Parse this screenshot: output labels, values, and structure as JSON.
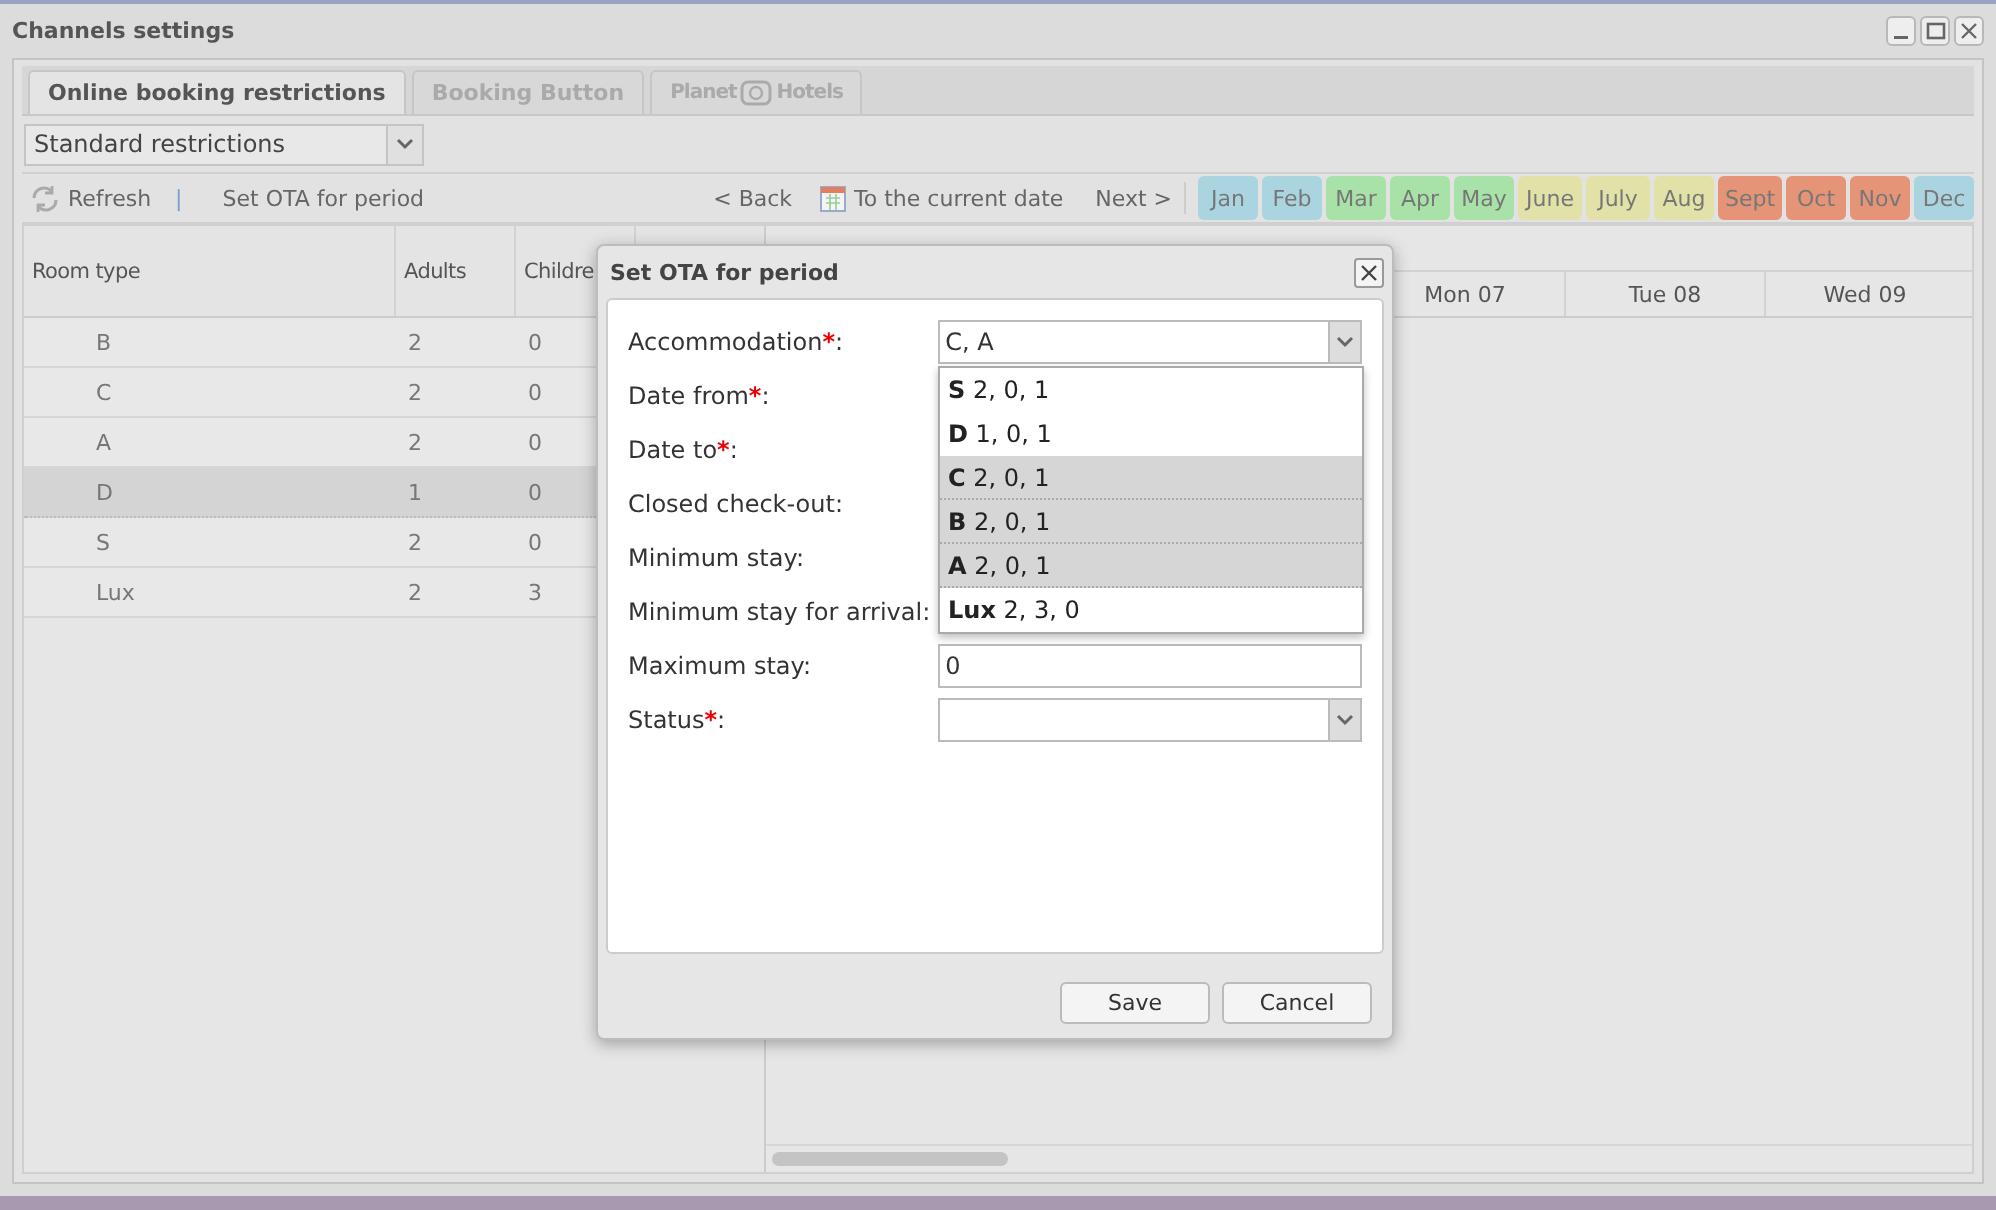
{
  "window": {
    "title": "Channels settings"
  },
  "tabs": [
    {
      "kind": "text",
      "label": "Online booking restrictions",
      "selected": true
    },
    {
      "kind": "text",
      "label": "Booking Button",
      "selected": false
    },
    {
      "kind": "logo",
      "parts": [
        "Planet",
        "Hotels"
      ],
      "selected": false
    }
  ],
  "restriction_type": {
    "value": "Standard restrictions"
  },
  "toolbar": {
    "refresh": "Refresh",
    "separator": "|",
    "set_ota": "Set OTA for period",
    "back": "< Back",
    "current_date": "To the current date",
    "next": "Next >"
  },
  "months": [
    {
      "label": "Jan",
      "color": "#a9d4e0"
    },
    {
      "label": "Feb",
      "color": "#a9d4e0"
    },
    {
      "label": "Mar",
      "color": "#a8e2a8"
    },
    {
      "label": "Apr",
      "color": "#a8e2a8"
    },
    {
      "label": "May",
      "color": "#a8e2a8"
    },
    {
      "label": "June",
      "color": "#e2e2a8"
    },
    {
      "label": "July",
      "color": "#e2e2a8"
    },
    {
      "label": "Aug",
      "color": "#e2e2a8"
    },
    {
      "label": "Sept",
      "color": "#e69478"
    },
    {
      "label": "Oct",
      "color": "#e69478"
    },
    {
      "label": "Nov",
      "color": "#e69478"
    },
    {
      "label": "Dec",
      "color": "#a9d4e0"
    }
  ],
  "table": {
    "columns": [
      "Room type",
      "Adults",
      "Childre"
    ],
    "rows": [
      {
        "cells": [
          "B",
          "2",
          "0"
        ],
        "selected": false
      },
      {
        "cells": [
          "C",
          "2",
          "0"
        ],
        "selected": false
      },
      {
        "cells": [
          "A",
          "2",
          "0"
        ],
        "selected": false
      },
      {
        "cells": [
          "D",
          "1",
          "0"
        ],
        "selected": true
      },
      {
        "cells": [
          "S",
          "2",
          "0"
        ],
        "selected": false
      },
      {
        "cells": [
          "Lux",
          "2",
          "3"
        ],
        "selected": false
      }
    ]
  },
  "calendar": {
    "days": [
      "Mon 07",
      "Tue 08",
      "Wed 09"
    ]
  },
  "dialog": {
    "title": "Set OTA for period",
    "fields": [
      {
        "label": "Accommodation",
        "required": "*",
        "suffix": ":",
        "kind": "combo",
        "value": "C, A"
      },
      {
        "label": "Date from",
        "required": "*",
        "suffix": ":",
        "kind": "covered"
      },
      {
        "label": "Date to",
        "required": "*",
        "suffix": ":",
        "kind": "covered"
      },
      {
        "label": "Closed check-out:",
        "kind": "covered"
      },
      {
        "label": "Minimum stay:",
        "kind": "covered"
      },
      {
        "label": "Minimum stay for arrival:",
        "kind": "covered"
      },
      {
        "label": "Maximum stay:",
        "kind": "text",
        "value": "0"
      },
      {
        "label": "Status",
        "required": "*",
        "suffix": ":",
        "kind": "combo"
      }
    ],
    "options": [
      {
        "text": "**S** 2, 0, 1",
        "selected": false
      },
      {
        "text": "**D** 1, 0, 1",
        "selected": false
      },
      {
        "text": "**C** 2, 0, 1",
        "selected": true
      },
      {
        "text": "**B** 2, 0, 1",
        "selected": true
      },
      {
        "text": "**A** 2, 0, 1",
        "selected": true
      },
      {
        "text": "**Lux** 2, 3, 0",
        "selected": false
      }
    ],
    "buttons": [
      "Save",
      "Cancel"
    ]
  }
}
